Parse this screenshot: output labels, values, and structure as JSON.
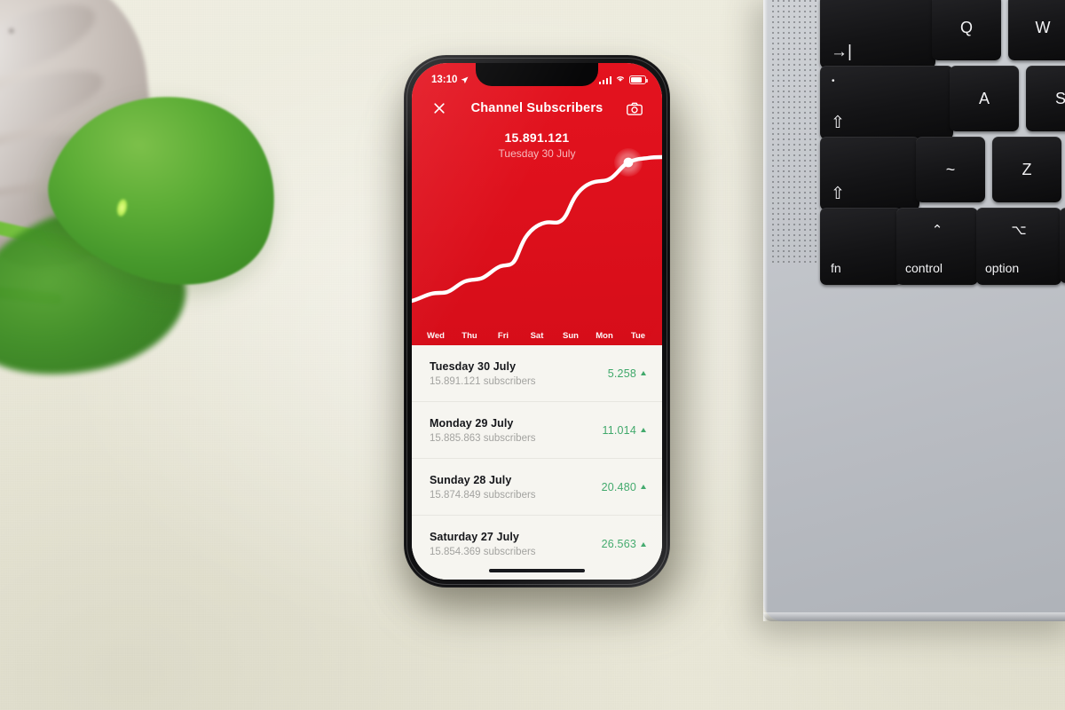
{
  "scene": {
    "desk_color": "#ecebdd",
    "objects": {
      "plant_leaf": "plant-leaf",
      "stone_pot": "stone-pot",
      "laptop": "macbook-keyboard"
    }
  },
  "laptop": {
    "keys": [
      {
        "label": "→|",
        "name": "tab-key"
      },
      {
        "label": "Q",
        "name": "q-key"
      },
      {
        "label": "W",
        "name": "w-key"
      },
      {
        "label": "⇧",
        "name": "caps-lock-key"
      },
      {
        "label": "A",
        "name": "a-key"
      },
      {
        "label": "S",
        "name": "s-key"
      },
      {
        "label": "⇧",
        "name": "shift-key"
      },
      {
        "label": "~",
        "name": "tilde-key"
      },
      {
        "label": "Z",
        "name": "z-key"
      },
      {
        "label": "fn",
        "name": "fn-key"
      },
      {
        "label": "control",
        "name": "control-key"
      },
      {
        "label": "option",
        "name": "option-key"
      }
    ],
    "caps_dot": "•",
    "control_glyph": "⌃",
    "option_glyph": "⌥"
  },
  "phone": {
    "statusbar": {
      "time": "13:10",
      "location_icon": "location-arrow-icon",
      "signal_icon": "signal-bars-icon",
      "wifi_icon": "wifi-icon",
      "battery_icon": "battery-icon"
    },
    "nav": {
      "close_label": "×",
      "title": "Channel Subscribers",
      "camera_label": "camera"
    },
    "headline": {
      "count": "15.891.121",
      "date": "Tuesday 30 July"
    },
    "home_indicator": "home-indicator"
  },
  "chart_data": {
    "type": "line",
    "title": "Channel Subscribers",
    "subtitle": "Tuesday 30 July",
    "xlabel": "",
    "ylabel": "Subscribers",
    "categories": [
      "Wed",
      "Thu",
      "Fri",
      "Sat",
      "Sun",
      "Mon",
      "Tue"
    ],
    "tick_labels": [
      "Wed",
      "Thu",
      "Fri",
      "Sat",
      "Sun",
      "Mon",
      "Tue"
    ],
    "series": [
      {
        "name": "Subscribers",
        "color": "#ffffff",
        "x": [
          0,
          0.5,
          1,
          1.5,
          2,
          2.5,
          3,
          3.5,
          4,
          4.5,
          5,
          5.5,
          6
        ],
        "values": [
          15710000,
          15728000,
          15748000,
          15762000,
          15786000,
          15800000,
          15824000,
          15836000,
          15854369,
          15866000,
          15874849,
          15885863,
          15891121
        ]
      }
    ],
    "ylim": [
      15700000,
      15900000
    ],
    "grid": false,
    "legend": "none",
    "highlight_point": {
      "label": "Tuesday 30 July",
      "value": 15891121,
      "x_category": "Tue",
      "marker": "white-dot-with-halo"
    },
    "plot_background": "#de101c",
    "line_color": "#ffffff"
  },
  "list": {
    "rows": [
      {
        "title": "Tuesday 30 July",
        "subtitle": "15.891.121 subscribers",
        "delta": "5.258",
        "direction": "up",
        "color": "#3fa86a"
      },
      {
        "title": "Monday 29 July",
        "subtitle": "15.885.863 subscribers",
        "delta": "11.014",
        "direction": "up",
        "color": "#3fa86a"
      },
      {
        "title": "Sunday 28 July",
        "subtitle": "15.874.849 subscribers",
        "delta": "20.480",
        "direction": "up",
        "color": "#3fa86a"
      },
      {
        "title": "Saturday 27 July",
        "subtitle": "15.854.369 subscribers",
        "delta": "26.563",
        "direction": "up",
        "color": "#3fa86a"
      }
    ]
  },
  "colors": {
    "brand_red": "#de101c",
    "accent_green": "#3fa86a",
    "list_bg": "#f6f5f0",
    "desk": "#ecebdd"
  }
}
